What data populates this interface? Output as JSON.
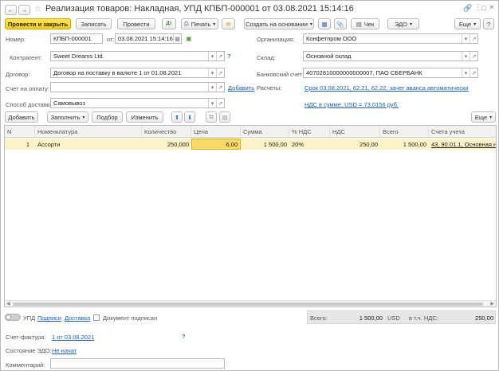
{
  "window": {
    "title": "Реализация товаров: Накладная, УПД КПБП-000001 от 03.08.2021 15:14:16"
  },
  "toolbar": {
    "post_close": "Провести и закрыть",
    "save": "Записать",
    "post": "Провести",
    "print": "Печать",
    "create_based": "Создать на основании",
    "receipt": "Чек",
    "edo": "ЭДО",
    "more": "Еще",
    "help": "?"
  },
  "form": {
    "number_label": "Номер:",
    "number_value": "КПБП-000001",
    "date_label": "от:",
    "date_value": "03.08.2021 15:14:16",
    "org_label": "Организация:",
    "org_value": "Конфетпром ООО",
    "counterparty_label": "Контрагент:",
    "counterparty_value": "Sweet Dreams Ltd.",
    "warehouse_label": "Склад:",
    "warehouse_value": "Основной склад",
    "contract_label": "Договор:",
    "contract_value": "Договор на поставку в валюте 1 от 01.08.2021",
    "bank_label": "Банковский счет:",
    "bank_value": "40702810000000000007, ПАО СБЕРБАНК",
    "invoice_label": "Счет на оплату:",
    "invoice_value": "",
    "add_link": "Добавить",
    "settlements_label": "Расчеты:",
    "settlements_link": "Срок 03.08.2021, 62.21, 62.22, зачет аванса автоматически",
    "vat_link": "НДС в сумме, USD = 73,0156 руб.",
    "delivery_label": "Способ доставки:",
    "delivery_value": "Самовывоз"
  },
  "table_toolbar": {
    "add": "Добавить",
    "fill": "Заполнить",
    "pick": "Подбор",
    "change": "Изменить",
    "more": "Еще"
  },
  "table": {
    "columns": [
      "N",
      "Номенклатура",
      "Количество",
      "Цена",
      "Сумма",
      "% НДС",
      "НДС",
      "Всего",
      "Счета учета"
    ],
    "rows": [
      {
        "n": "1",
        "item": "Ассорти",
        "qty": "250,000",
        "price": "6,00",
        "sum": "1 500,00",
        "vat_rate": "20%",
        "vat": "250,00",
        "total": "1 500,00",
        "accounts": "43, 90.01.1, Основная но"
      }
    ]
  },
  "footer": {
    "upd_label": "УПД",
    "signatures_link": "Подписи",
    "delivery_link": "Доставка",
    "signed_label": "Документ подписан",
    "total_label": "Всего:",
    "total_value": "1 500,00",
    "currency": "USD",
    "vat_incl_label": "в т.ч. НДС:",
    "vat_incl_value": "250,00",
    "invoice_doc_label": "Счет-фактура:",
    "invoice_doc_link": "1 от 03.08.2021",
    "edo_state_label": "Состояние ЭДО:",
    "edo_state_link": "Не начат",
    "comment_label": "Комментарий:",
    "comment_value": "",
    "help": "?"
  },
  "colors": {
    "primary_button": "#f7cf10",
    "selected_row": "#fbf3c8",
    "price_cell": "#f9d96a",
    "link": "#1a5fb4"
  }
}
